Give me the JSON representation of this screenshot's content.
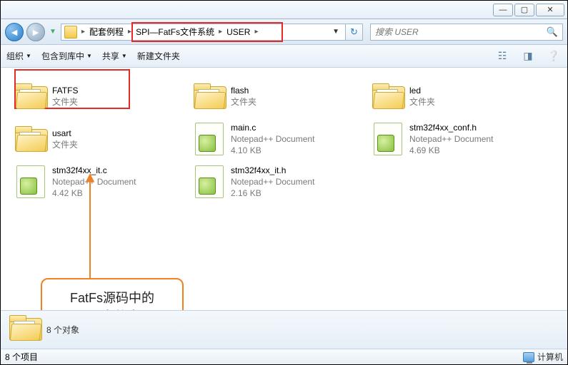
{
  "window": {
    "minimize_glyph": "—",
    "maximize_glyph": "▢",
    "close_glyph": "✕"
  },
  "nav": {
    "back_glyph": "◄",
    "fwd_glyph": "►",
    "dropdown_glyph": "▼",
    "refresh_glyph": "↻"
  },
  "breadcrumbs": {
    "root_sep": "▸",
    "p1": "配套例程",
    "p2": "SPI—FatFs文件系统",
    "p3": "USER"
  },
  "search": {
    "placeholder": "搜索 USER",
    "icon_glyph": "🔍"
  },
  "toolbar": {
    "organize": "组织",
    "include": "包含到库中",
    "share": "共享",
    "newfolder": "新建文件夹",
    "dd_glyph": "▼"
  },
  "items": [
    {
      "name": "FATFS",
      "type": "folder",
      "sub1": "文件夹",
      "sub2": ""
    },
    {
      "name": "flash",
      "type": "folder",
      "sub1": "文件夹",
      "sub2": ""
    },
    {
      "name": "led",
      "type": "folder",
      "sub1": "文件夹",
      "sub2": ""
    },
    {
      "name": "usart",
      "type": "folder",
      "sub1": "文件夹",
      "sub2": ""
    },
    {
      "name": "main.c",
      "type": "file",
      "sub1": "Notepad++ Document",
      "sub2": "4.10 KB"
    },
    {
      "name": "stm32f4xx_conf.h",
      "type": "file",
      "sub1": "Notepad++ Document",
      "sub2": "4.69 KB"
    },
    {
      "name": "stm32f4xx_it.c",
      "type": "file",
      "sub1": "Notepad++ Document",
      "sub2": "4.42 KB"
    },
    {
      "name": "stm32f4xx_it.h",
      "type": "file",
      "sub1": "Notepad++ Document",
      "sub2": "2.16 KB"
    }
  ],
  "callout": {
    "line1": "FatFs源码中的",
    "line2": "src文件夹"
  },
  "details": {
    "text": "8 个对象"
  },
  "status": {
    "left": "8 个项目",
    "right": "计算机"
  }
}
